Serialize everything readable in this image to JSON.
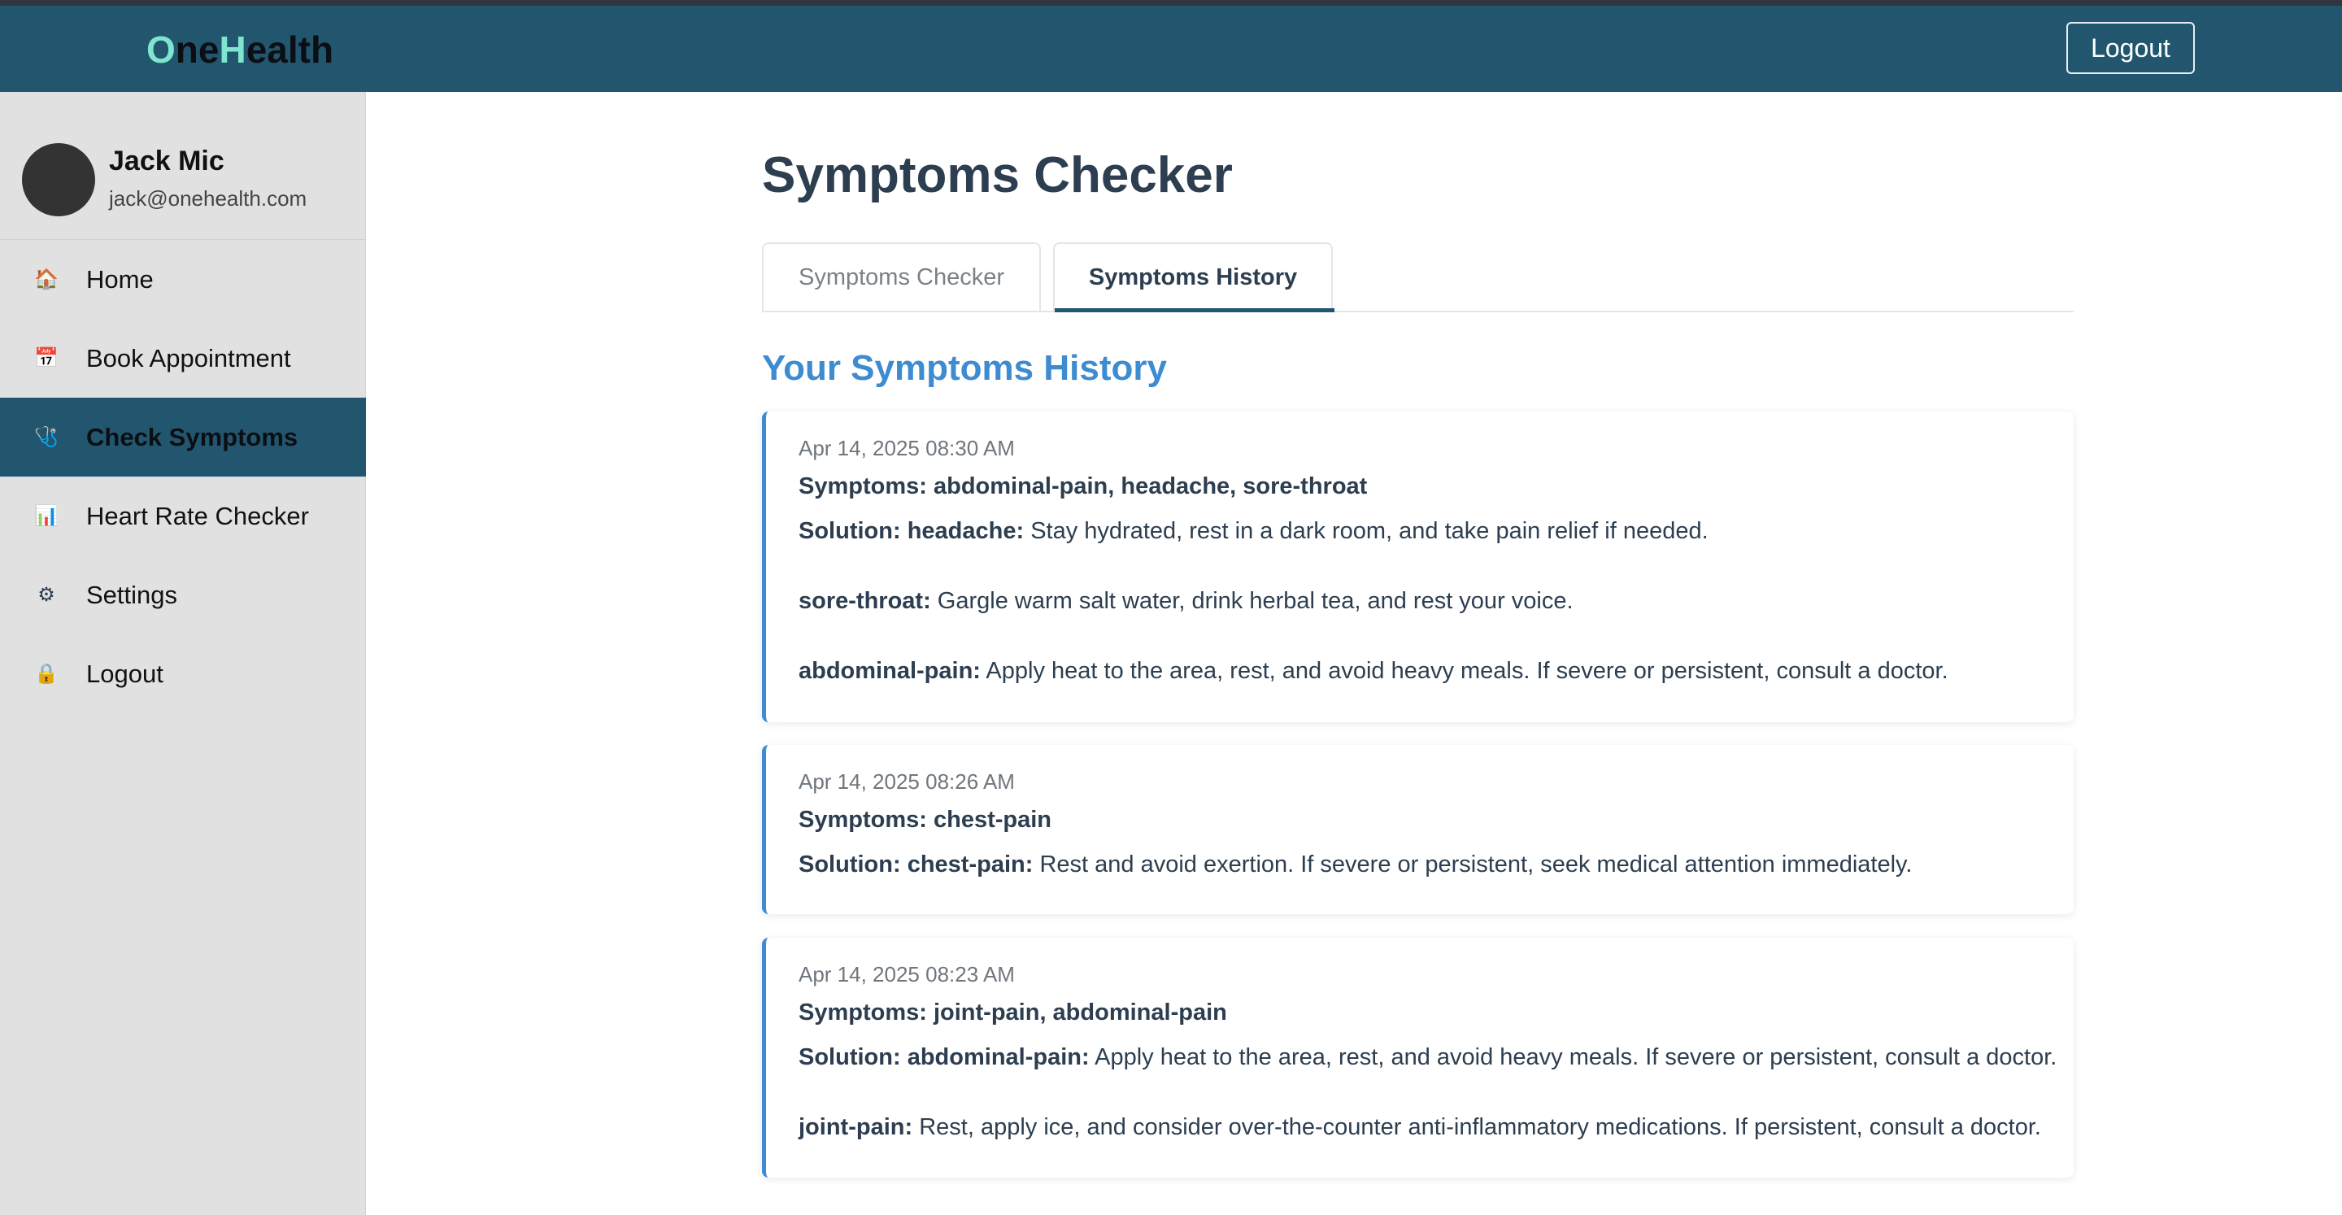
{
  "app": {
    "logo_letters": [
      "O",
      "ne",
      "H",
      "ealth"
    ],
    "header_logout_label": "Logout"
  },
  "user": {
    "name": "Jack Mic",
    "email": "jack@onehealth.com"
  },
  "sidebar": {
    "items": [
      {
        "label": "Home",
        "icon": "house-icon",
        "glyph": "🏠",
        "active": false
      },
      {
        "label": "Book Appointment",
        "icon": "calendar-icon",
        "glyph": "📅",
        "active": false
      },
      {
        "label": "Check Symptoms",
        "icon": "stethoscope-icon",
        "glyph": "🩺",
        "active": true
      },
      {
        "label": "Heart Rate Checker",
        "icon": "bar-chart-icon",
        "glyph": "📊",
        "active": false
      },
      {
        "label": "Settings",
        "icon": "gear-icon",
        "glyph": "⚙",
        "active": false
      },
      {
        "label": "Logout",
        "icon": "lock-icon",
        "glyph": "🔒",
        "active": false
      }
    ]
  },
  "main": {
    "title": "Symptoms Checker",
    "tabs": [
      {
        "label": "Symptoms Checker",
        "active": false
      },
      {
        "label": "Symptoms History",
        "active": true
      }
    ],
    "history_title": "Your Symptoms History",
    "history": [
      {
        "date": "Apr 14, 2025 08:30 AM",
        "symptoms_text": "Symptoms: abdominal-pain, headache, sore-throat",
        "solution_prefix": "Solution:",
        "solutions": [
          {
            "name": "headache:",
            "text": "Stay hydrated, rest in a dark room, and take pain relief if needed."
          },
          {
            "name": "sore-throat:",
            "text": "Gargle warm salt water, drink herbal tea, and rest your voice."
          },
          {
            "name": "abdominal-pain:",
            "text": "Apply heat to the area, rest, and avoid heavy meals. If severe or persistent, consult a doctor."
          }
        ]
      },
      {
        "date": "Apr 14, 2025 08:26 AM",
        "symptoms_text": "Symptoms: chest-pain",
        "solution_prefix": "Solution:",
        "solutions": [
          {
            "name": "chest-pain:",
            "text": "Rest and avoid exertion. If severe or persistent, seek medical attention immediately."
          }
        ]
      },
      {
        "date": "Apr 14, 2025 08:23 AM",
        "symptoms_text": "Symptoms: joint-pain, abdominal-pain",
        "solution_prefix": "Solution:",
        "solutions": [
          {
            "name": "abdominal-pain:",
            "text": "Apply heat to the area, rest, and avoid heavy meals. If severe or persistent, consult a doctor."
          },
          {
            "name": "joint-pain:",
            "text": "Rest, apply ice, and consider over-the-counter anti-inflammatory medications. If persistent, consult a doctor."
          }
        ]
      }
    ]
  },
  "colors": {
    "header_bg": "#22566f",
    "sidebar_bg": "#e1e1e1",
    "accent_blue": "#3d8bd0",
    "logo_accent": "#7fe5cf",
    "text_dark": "#2c3e50"
  }
}
